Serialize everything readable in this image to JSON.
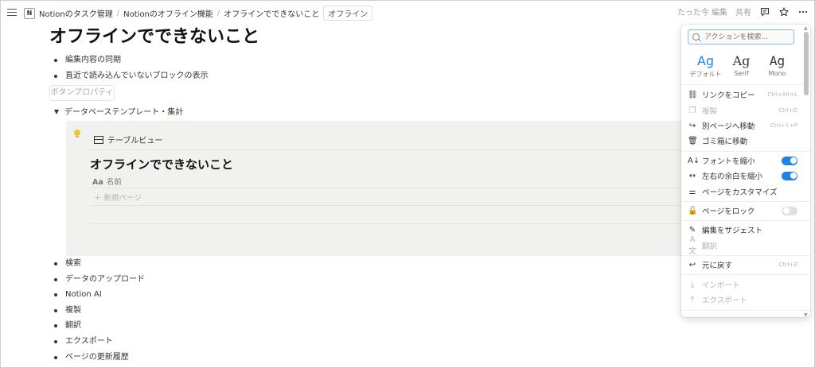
{
  "topbar": {
    "crumbs": [
      "Notionのタスク管理",
      "Notionのオフライン機能",
      "オフラインでできないこと"
    ],
    "separator": "/",
    "badge": "オフライン",
    "edited": "たった今 編集",
    "share": "共有",
    "logo_letter": "N"
  },
  "page": {
    "title": "オフラインでできないこと",
    "bullets_top": [
      "編集内容の同期",
      "直近で読み込んでいないブロックの表示"
    ],
    "button_property": "ボタンプロパティ",
    "toggle_label": "データベーステンプレート・集計",
    "bullets_bottom": [
      "検索",
      "データのアップロード",
      "Notion AI",
      "複製",
      "翻訳",
      "エクスポート",
      "ページの更新履歴"
    ]
  },
  "database": {
    "view_tab": "テーブルビュー",
    "title": "オフラインでできないこと",
    "col_icon": "Aa",
    "col_name": "名前",
    "new_page": "新規ページ"
  },
  "menu": {
    "search_placeholder": "アクションを検索...",
    "fonts": [
      {
        "glyph": "Ag",
        "label": "デフォルト",
        "active": true
      },
      {
        "glyph": "Ag",
        "label": "Serif",
        "active": false
      },
      {
        "glyph": "Ag",
        "label": "Mono",
        "active": false
      }
    ],
    "items": [
      {
        "icon": "link-icon",
        "label": "リンクをコピー",
        "shortcut": "Ctrl+Alt+L",
        "disabled": false
      },
      {
        "icon": "duplicate-icon",
        "label": "複製",
        "shortcut": "Ctrl+D",
        "disabled": true
      },
      {
        "icon": "move-icon",
        "label": "別ページへ移動",
        "shortcut": "Ctrl+⇧+P",
        "disabled": false
      },
      {
        "icon": "trash-icon",
        "label": "ゴミ箱に移動",
        "shortcut": "",
        "disabled": false
      },
      {
        "icon": "small-text-icon",
        "label": "フォントを縮小",
        "toggle": "on"
      },
      {
        "icon": "full-width-icon",
        "label": "左右の余白を縮小",
        "toggle": "on"
      },
      {
        "icon": "customize-icon",
        "label": "ページをカスタマイズ",
        "shortcut": ""
      },
      {
        "icon": "lock-icon",
        "label": "ページをロック",
        "toggle": "off"
      },
      {
        "icon": "suggest-icon",
        "label": "編集をサジェスト",
        "shortcut": ""
      },
      {
        "icon": "translate-icon",
        "label": "翻訳",
        "shortcut": "",
        "disabled": true
      },
      {
        "icon": "undo-icon",
        "label": "元に戻す",
        "shortcut": "Ctrl+Z"
      },
      {
        "icon": "import-icon",
        "label": "インポート",
        "disabled": true
      },
      {
        "icon": "export-icon",
        "label": "エクスポート",
        "disabled": true
      }
    ]
  },
  "colors": {
    "accent": "#2383e2",
    "text": "#37352f",
    "callout_bg": "#f1f1ef"
  }
}
